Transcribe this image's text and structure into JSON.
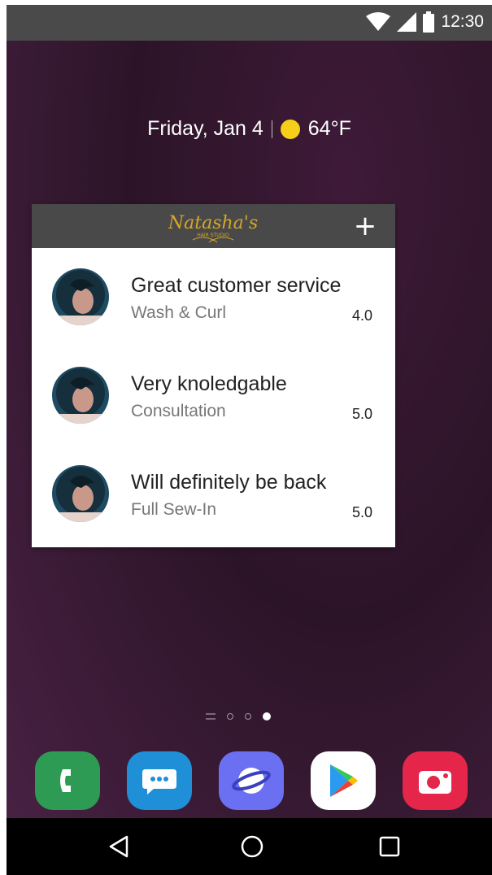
{
  "status_bar": {
    "time": "12:30",
    "icons": [
      "wifi-icon",
      "cell-signal-icon",
      "battery-icon"
    ]
  },
  "home": {
    "date": "Friday, Jan 4",
    "weather_icon": "sun-icon",
    "temperature": "64°F"
  },
  "widget": {
    "logo_icon": "natashas-hair-studio-logo",
    "add_icon": "+",
    "reviews": [
      {
        "title": "Great customer service",
        "service": "Wash & Curl",
        "rating": "4.0"
      },
      {
        "title": "Very knoledgable",
        "service": "Consultation",
        "rating": "5.0"
      },
      {
        "title": "Will definitely be back",
        "service": "Full Sew-In",
        "rating": "5.0"
      }
    ]
  },
  "page_indicator": {
    "pages": 3,
    "active_page": 3
  },
  "dock": {
    "apps": [
      {
        "icon": "phone-icon",
        "color": "#2e9b55"
      },
      {
        "icon": "messages-icon",
        "color": "#1f8fd8"
      },
      {
        "icon": "internet-browser-icon",
        "color": "#6b6ff2"
      },
      {
        "icon": "play-store-icon",
        "color": "#ffffff"
      },
      {
        "icon": "camera-icon",
        "color": "#e5264a"
      }
    ]
  },
  "nav_bar": {
    "buttons": [
      "back-icon",
      "home-icon",
      "recents-icon"
    ]
  },
  "colors": {
    "widget_header": "#494949",
    "status_bar": "#4a4a4a",
    "logo_gold": "#d4a62a",
    "sun": "#f6cf1b"
  }
}
